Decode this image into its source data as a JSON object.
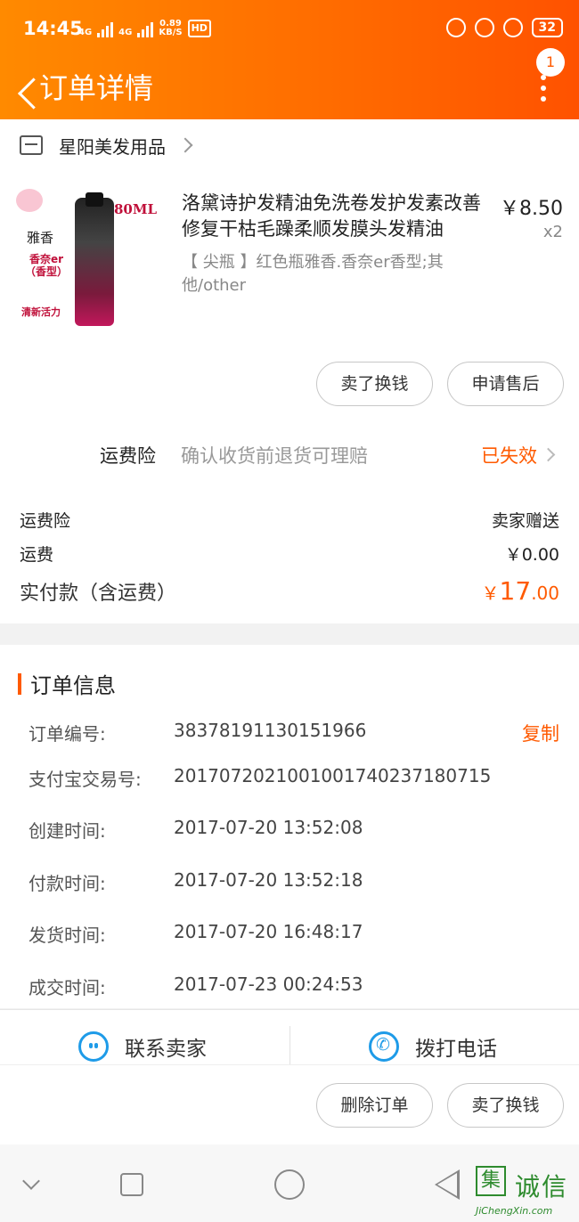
{
  "status_bar": {
    "time": "14:45",
    "signal1": "4G",
    "signal2": "4G",
    "speed_value": "0.89",
    "speed_unit": "KB/S",
    "hd": "HD",
    "battery": "32"
  },
  "nav": {
    "title": "订单详情",
    "badge": "1"
  },
  "shop": {
    "name": "星阳美发用品"
  },
  "product": {
    "image_texts": {
      "volume": "80ML",
      "scent": "雅香",
      "line1": "香奈er（香型）",
      "line2": "清新活力"
    },
    "title": "洛黛诗护发精油免洗卷发护发素改善修复干枯毛躁柔顺发膜头发精油",
    "price": "￥8.50",
    "qty": "x2",
    "sku": "【 尖瓶 】红色瓶雅香.香奈er香型;其他/other"
  },
  "item_buttons": {
    "sell": "卖了换钱",
    "after_sale": "申请售后"
  },
  "insurance": {
    "label": "运费险",
    "desc": "确认收货前退货可理赔",
    "status": "已失效"
  },
  "fees": {
    "insurance_label": "运费险",
    "insurance_value": "卖家赠送",
    "shipping_label": "运费",
    "shipping_value": "￥0.00",
    "paid_label": "实付款（含运费）",
    "paid_symbol": "￥",
    "paid_int": "17",
    "paid_dec": ".00"
  },
  "order_info": {
    "title": "订单信息",
    "copy_label": "复制",
    "rows": [
      {
        "key": "订单编号:",
        "value": "38378191130151966"
      },
      {
        "key": "支付宝交易号:",
        "value": "2017072021001001740237180715"
      },
      {
        "key": "创建时间:",
        "value": "2017-07-20 13:52:08"
      },
      {
        "key": "付款时间:",
        "value": "2017-07-20 13:52:18"
      },
      {
        "key": "发货时间:",
        "value": "2017-07-20 16:48:17"
      },
      {
        "key": "成交时间:",
        "value": "2017-07-23 00:24:53"
      }
    ]
  },
  "contact": {
    "seller": "联系卖家",
    "phone": "拨打电话"
  },
  "actions": {
    "delete": "删除订单",
    "sell": "卖了换钱"
  },
  "watermark": {
    "box": "集",
    "cn": "诚信",
    "en": "JiChengXin.com"
  },
  "colors": {
    "accent": "#ff5a00",
    "header_start": "#ff8a00",
    "header_end": "#ff5200",
    "icon_blue": "#1e9be8"
  }
}
